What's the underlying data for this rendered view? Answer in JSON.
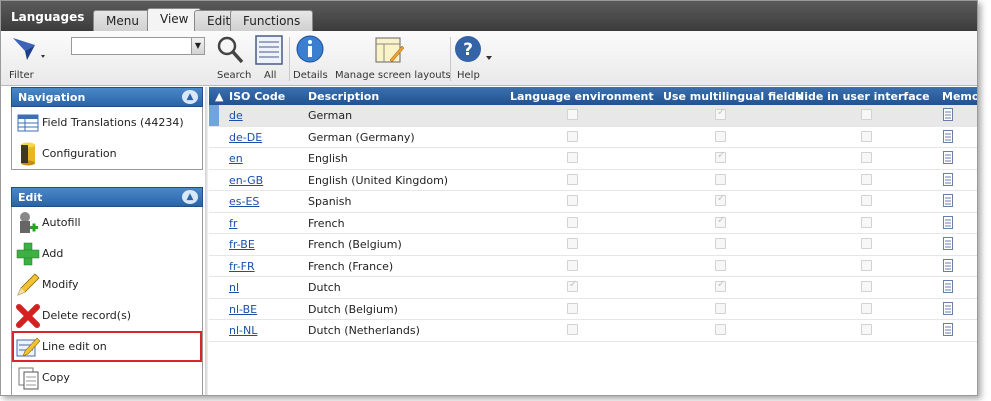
{
  "app": {
    "title": "Languages"
  },
  "tabs": [
    {
      "label": "Menu",
      "active": false
    },
    {
      "label": "View",
      "active": true
    },
    {
      "label": "Edit",
      "active": false
    },
    {
      "label": "Functions",
      "active": false
    }
  ],
  "ribbon": {
    "filter_label": "Filter",
    "search_value": "",
    "search_label": "Search",
    "all_label": "All",
    "details_label": "Details",
    "layouts_label": "Manage screen layouts",
    "help_label": "Help"
  },
  "navigation": {
    "title": "Navigation",
    "items": [
      {
        "label": "Field Translations (44234)",
        "icon": "table-icon"
      },
      {
        "label": "Configuration",
        "icon": "database-icon"
      }
    ]
  },
  "edit_panel": {
    "title": "Edit",
    "items": [
      {
        "label": "Autofill",
        "icon": "autofill-icon"
      },
      {
        "label": "Add",
        "icon": "plus-icon"
      },
      {
        "label": "Modify",
        "icon": "pencil-icon"
      },
      {
        "label": "Delete record(s)",
        "icon": "delete-icon"
      },
      {
        "label": "Line edit on",
        "icon": "line-edit-icon"
      },
      {
        "label": "Copy",
        "icon": "copy-icon"
      }
    ]
  },
  "grid": {
    "columns": {
      "iso": "ISO Code",
      "desc": "Description",
      "env": "Language environment",
      "multi": "Use multilingual fields",
      "hide": "Hide in user interface",
      "memo": "Memo"
    },
    "sort_indicator": "▲",
    "rows": [
      {
        "iso": "de",
        "desc": "German",
        "env": false,
        "multi": true,
        "hide": false
      },
      {
        "iso": "de-DE",
        "desc": "German (Germany)",
        "env": false,
        "multi": false,
        "hide": false
      },
      {
        "iso": "en",
        "desc": "English",
        "env": false,
        "multi": true,
        "hide": false
      },
      {
        "iso": "en-GB",
        "desc": "English (United Kingdom)",
        "env": false,
        "multi": false,
        "hide": false
      },
      {
        "iso": "es-ES",
        "desc": "Spanish",
        "env": false,
        "multi": true,
        "hide": false
      },
      {
        "iso": "fr",
        "desc": "French",
        "env": false,
        "multi": true,
        "hide": false
      },
      {
        "iso": "fr-BE",
        "desc": "French (Belgium)",
        "env": false,
        "multi": false,
        "hide": false
      },
      {
        "iso": "fr-FR",
        "desc": "French (France)",
        "env": false,
        "multi": false,
        "hide": false
      },
      {
        "iso": "nl",
        "desc": "Dutch",
        "env": true,
        "multi": true,
        "hide": false
      },
      {
        "iso": "nl-BE",
        "desc": "Dutch (Belgium)",
        "env": false,
        "multi": false,
        "hide": false
      },
      {
        "iso": "nl-NL",
        "desc": "Dutch (Netherlands)",
        "env": false,
        "multi": false,
        "hide": false
      }
    ]
  },
  "colors": {
    "accent": "#2a64a8",
    "link": "#1a4fa8",
    "highlight": "#d9262b"
  }
}
